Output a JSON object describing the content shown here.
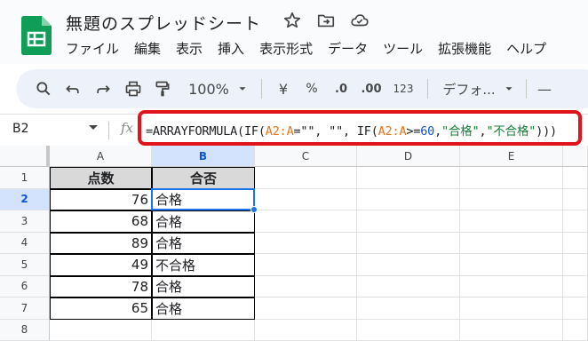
{
  "app": {
    "title": "無題のスプレッドシート",
    "menu": [
      "ファイル",
      "編集",
      "表示",
      "挿入",
      "表示形式",
      "データ",
      "ツール",
      "拡張機能",
      "ヘルプ"
    ]
  },
  "toolbar": {
    "zoom": "100%",
    "currency": "¥",
    "percent": "%",
    "dec_minus": ".0",
    "dec_plus": ".00",
    "format_123": "123",
    "font": "デフォ...",
    "minus": "—"
  },
  "formula_bar": {
    "name_box": "B2",
    "fx": "fx",
    "formula_parts": [
      {
        "t": "=ARRAYFORMULA(IF(",
        "k": "plain"
      },
      {
        "t": "A2:A",
        "k": "ref"
      },
      {
        "t": "=\"\"",
        "k": "plain"
      },
      {
        "t": ", \"\", IF(",
        "k": "plain"
      },
      {
        "t": "A2:A",
        "k": "ref"
      },
      {
        "t": ">=",
        "k": "plain"
      },
      {
        "t": "60",
        "k": "num"
      },
      {
        "t": ",",
        "k": "plain"
      },
      {
        "t": "\"合格\"",
        "k": "str"
      },
      {
        "t": ",",
        "k": "plain"
      },
      {
        "t": "\"不合格\"",
        "k": "str"
      },
      {
        "t": ")))",
        "k": "plain"
      }
    ]
  },
  "grid": {
    "columns": [
      "A",
      "B",
      "C",
      "D",
      "E"
    ],
    "selected_column": "B",
    "selected_row": "2",
    "rows": [
      "1",
      "2",
      "3",
      "4",
      "5",
      "6",
      "7",
      "8"
    ],
    "header_row": [
      "点数",
      "合否"
    ],
    "data": [
      [
        "76",
        "合格"
      ],
      [
        "68",
        "合格"
      ],
      [
        "89",
        "合格"
      ],
      [
        "49",
        "不合格"
      ],
      [
        "78",
        "合格"
      ],
      [
        "65",
        "合格"
      ]
    ]
  },
  "colors": {
    "accent": "#1a73e8",
    "highlight_box": "#e0141c",
    "logo_green": "#0f9d58"
  }
}
